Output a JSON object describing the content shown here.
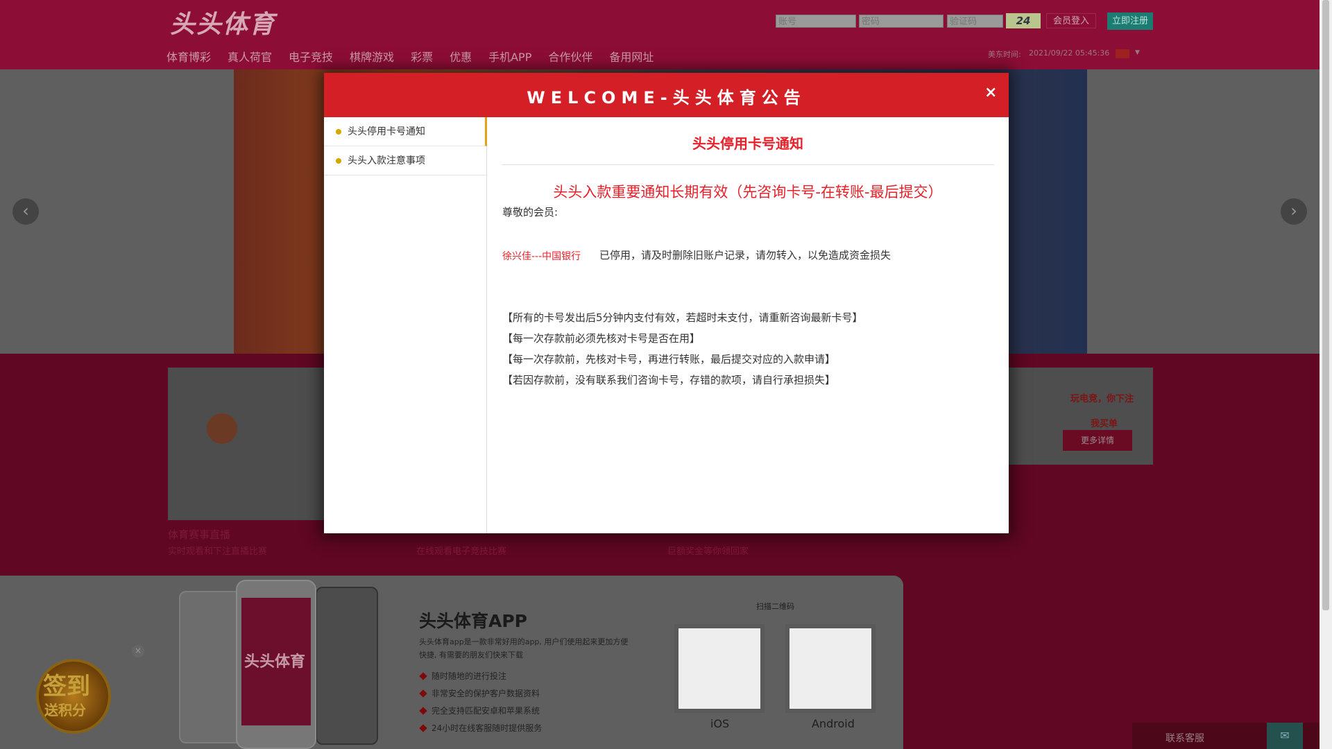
{
  "header": {
    "logo": "头头体育",
    "account_placeholder": "账号",
    "password_placeholder": "密码",
    "captcha_placeholder": "验证码",
    "captcha_code": "24",
    "login_label": "会员登入",
    "register_label": "立即注册",
    "nav": [
      "体育博彩",
      "真人荷官",
      "电子竞技",
      "棋牌游戏",
      "彩票",
      "优惠",
      "手机APP",
      "合作伙伴",
      "备用网址"
    ],
    "time_label": "美东时间:",
    "time_value": "2021/09/22 05:45:36"
  },
  "features": {
    "f1_title": "体育赛事直播",
    "f1_sub": "实时观看和下注直播比赛",
    "f2_sub": "在线观看电子竞技比赛",
    "f4_sub": "巨额奖金等你领回家",
    "f3_line1": "玩电竞，你下注",
    "f3_line2": "我买单",
    "f3_button": "更多详情"
  },
  "app": {
    "phone_text": "头头体育",
    "title": "头头体育APP",
    "desc": "头头体育app是一款非常好用的app, 用户们使用起来更加方便快捷, 有需要的朋友们快来下载",
    "bullets": [
      "随时随地的进行投注",
      "非常安全的保护客户数据资料",
      "完全支持匹配安卓和苹果系统",
      "24小时在线客服随时提供服务"
    ],
    "scan_label": "扫描二维码",
    "ios_label": "iOS",
    "android_label": "Android"
  },
  "signin": {
    "line1": "签到",
    "line2": "送积分"
  },
  "contact": {
    "label": "联系客服"
  },
  "modal": {
    "title": "WELCOME-头头体育公告",
    "close": "×",
    "side_items": [
      "头头停用卡号通知",
      "头头入款注意事项"
    ],
    "content_title": "头头停用卡号通知",
    "headline": "头头入款重要通知长期有效（先咨询卡号-在转账-最后提交）",
    "greeting": "尊敬的会员:",
    "bank": "徐兴佳---中国银行",
    "bank_msg": "已停用，请及时删除旧账户记录，请勿转入，以免造成资金损失",
    "rules": [
      "【所有的卡号发出后5分钟内支付有效，若超时未支付，请重新咨询最新卡号】",
      "【每一次存款前必须先核对卡号是否在用】",
      "【每一次存款前，先核对卡号，再进行转账，最后提交对应的入款申请】",
      "【若因存款前，没有联系我们咨询卡号，存错的款项，请自行承担损失】"
    ]
  },
  "colors": {
    "brand": "#8c0d35",
    "modal_header": "#d51f26",
    "accent_text": "#e8202a",
    "register_btn": "#1c7c72"
  }
}
